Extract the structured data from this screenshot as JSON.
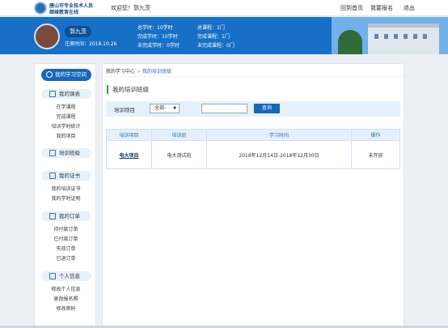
{
  "header": {
    "logo_line1": "唐山市专业技术人员",
    "logo_line2": "继续教育在线",
    "welcome": "欢迎您！郭九茨",
    "nav": [
      "回到首页",
      "我要报名",
      "退出"
    ]
  },
  "profile": {
    "name": "郭九茨",
    "reg_time": "注册时间：2018.10.26",
    "stats": [
      "总学时：10学时",
      "完成学时：10学时",
      "未完成学时：0学时",
      "总课程：1门",
      "完成课程：1门",
      "未完成课程：0门"
    ]
  },
  "sidebar": {
    "home": "我的学习空间",
    "sections": [
      {
        "title": "我的课表",
        "icon": "book-icon",
        "items": [
          "在学课程",
          "完成课程",
          "培训学时统计",
          "我的项目"
        ]
      },
      {
        "title": "培训班级",
        "icon": "class-icon",
        "items": []
      },
      {
        "title": "我的证书",
        "icon": "certificate-icon",
        "items": [
          "我的培训证书",
          "我的学时证明"
        ]
      },
      {
        "title": "我的订单",
        "icon": "cart-icon",
        "items": [
          "待付款订单",
          "已付款订单",
          "失效订单",
          "已退订单"
        ]
      },
      {
        "title": "个人信息",
        "icon": "profile-icon",
        "items": [
          "修改个人信息",
          "更改报名照",
          "修改密码"
        ]
      }
    ]
  },
  "main": {
    "crumb_root": "我的学习中心",
    "crumb_sep": ">",
    "crumb_current": "我的培训班级",
    "title": "我的培训班级",
    "filter": {
      "label": "培训项目",
      "select_value": "-全部-",
      "select_arrow": "▼",
      "search_value": "",
      "search_button": "查询"
    },
    "table": {
      "headers": [
        "培训项目",
        "培训班",
        "学习时间",
        "操作"
      ],
      "rows": [
        [
          "电大项目",
          "电大测试班",
          "2018年12月14日-2018年12月30日",
          "未开放"
        ]
      ]
    }
  }
}
